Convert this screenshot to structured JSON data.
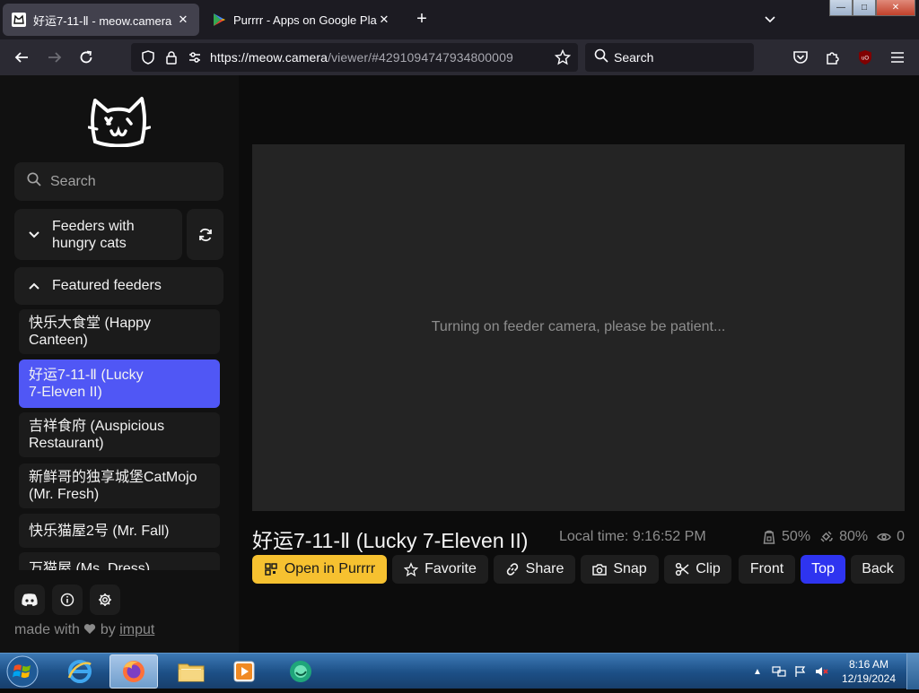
{
  "browser": {
    "tabs": [
      {
        "title": "好运7-11-Ⅱ - meow.camera",
        "active": true,
        "icon": "meow-camera-favicon"
      },
      {
        "title": "Purrrr - Apps on Google Play",
        "active": false,
        "icon": "google-play-favicon"
      }
    ],
    "url_main": "https://meow.camera",
    "url_rest": "/viewer/#4291094747934800009",
    "search_placeholder": "Search",
    "window_controls": {
      "minimize": "—",
      "maximize": "□",
      "close": "✕"
    }
  },
  "sidebar": {
    "search_placeholder": "Search",
    "groups": [
      {
        "label_line1": "Feeders with",
        "label_line2": "hungry cats",
        "expanded": false
      },
      {
        "label": "Featured feeders",
        "expanded": true
      }
    ],
    "feeders": [
      {
        "line1": "快乐大食堂 (Happy",
        "line2": "Canteen)",
        "active": false
      },
      {
        "line1": "好运7-11-Ⅱ (Lucky",
        "line2": "7-Eleven II)",
        "active": true
      },
      {
        "line1": "吉祥食府 (Auspicious",
        "line2": "Restaurant)",
        "active": false
      },
      {
        "line1": "新鲜哥的独享城堡CatMojo",
        "line2": "(Mr. Fresh)",
        "active": false
      },
      {
        "line1": "快乐猫屋2号 (Mr. Fall)",
        "line2": "",
        "active": false
      },
      {
        "line1": "万猫屋 (Ms. Dress)",
        "line2": "",
        "active": false
      }
    ],
    "footer": {
      "made_with": "made with",
      "by": "by",
      "author": "imput"
    }
  },
  "viewer": {
    "status_message": "Turning on feeder camera, please be patient...",
    "feeder_title": "好运7-11-Ⅱ (Lucky 7-Eleven II)",
    "local_time": "Local time: 9:16:52 PM",
    "stats": {
      "food": "50%",
      "battery": "80%",
      "viewers": "0"
    },
    "actions": {
      "open": "Open in Purrrr",
      "favorite": "Favorite",
      "share": "Share",
      "snap": "Snap",
      "clip": "Clip",
      "front": "Front",
      "top": "Top",
      "back": "Back"
    }
  },
  "taskbar": {
    "time": "8:16 AM",
    "date": "12/19/2024",
    "apps": [
      "internet-explorer",
      "firefox",
      "file-explorer",
      "media-player",
      "app-green"
    ]
  },
  "colors": {
    "accent": "#5057f5",
    "primary_button": "#f6c130",
    "top_button": "#2e34f0"
  }
}
